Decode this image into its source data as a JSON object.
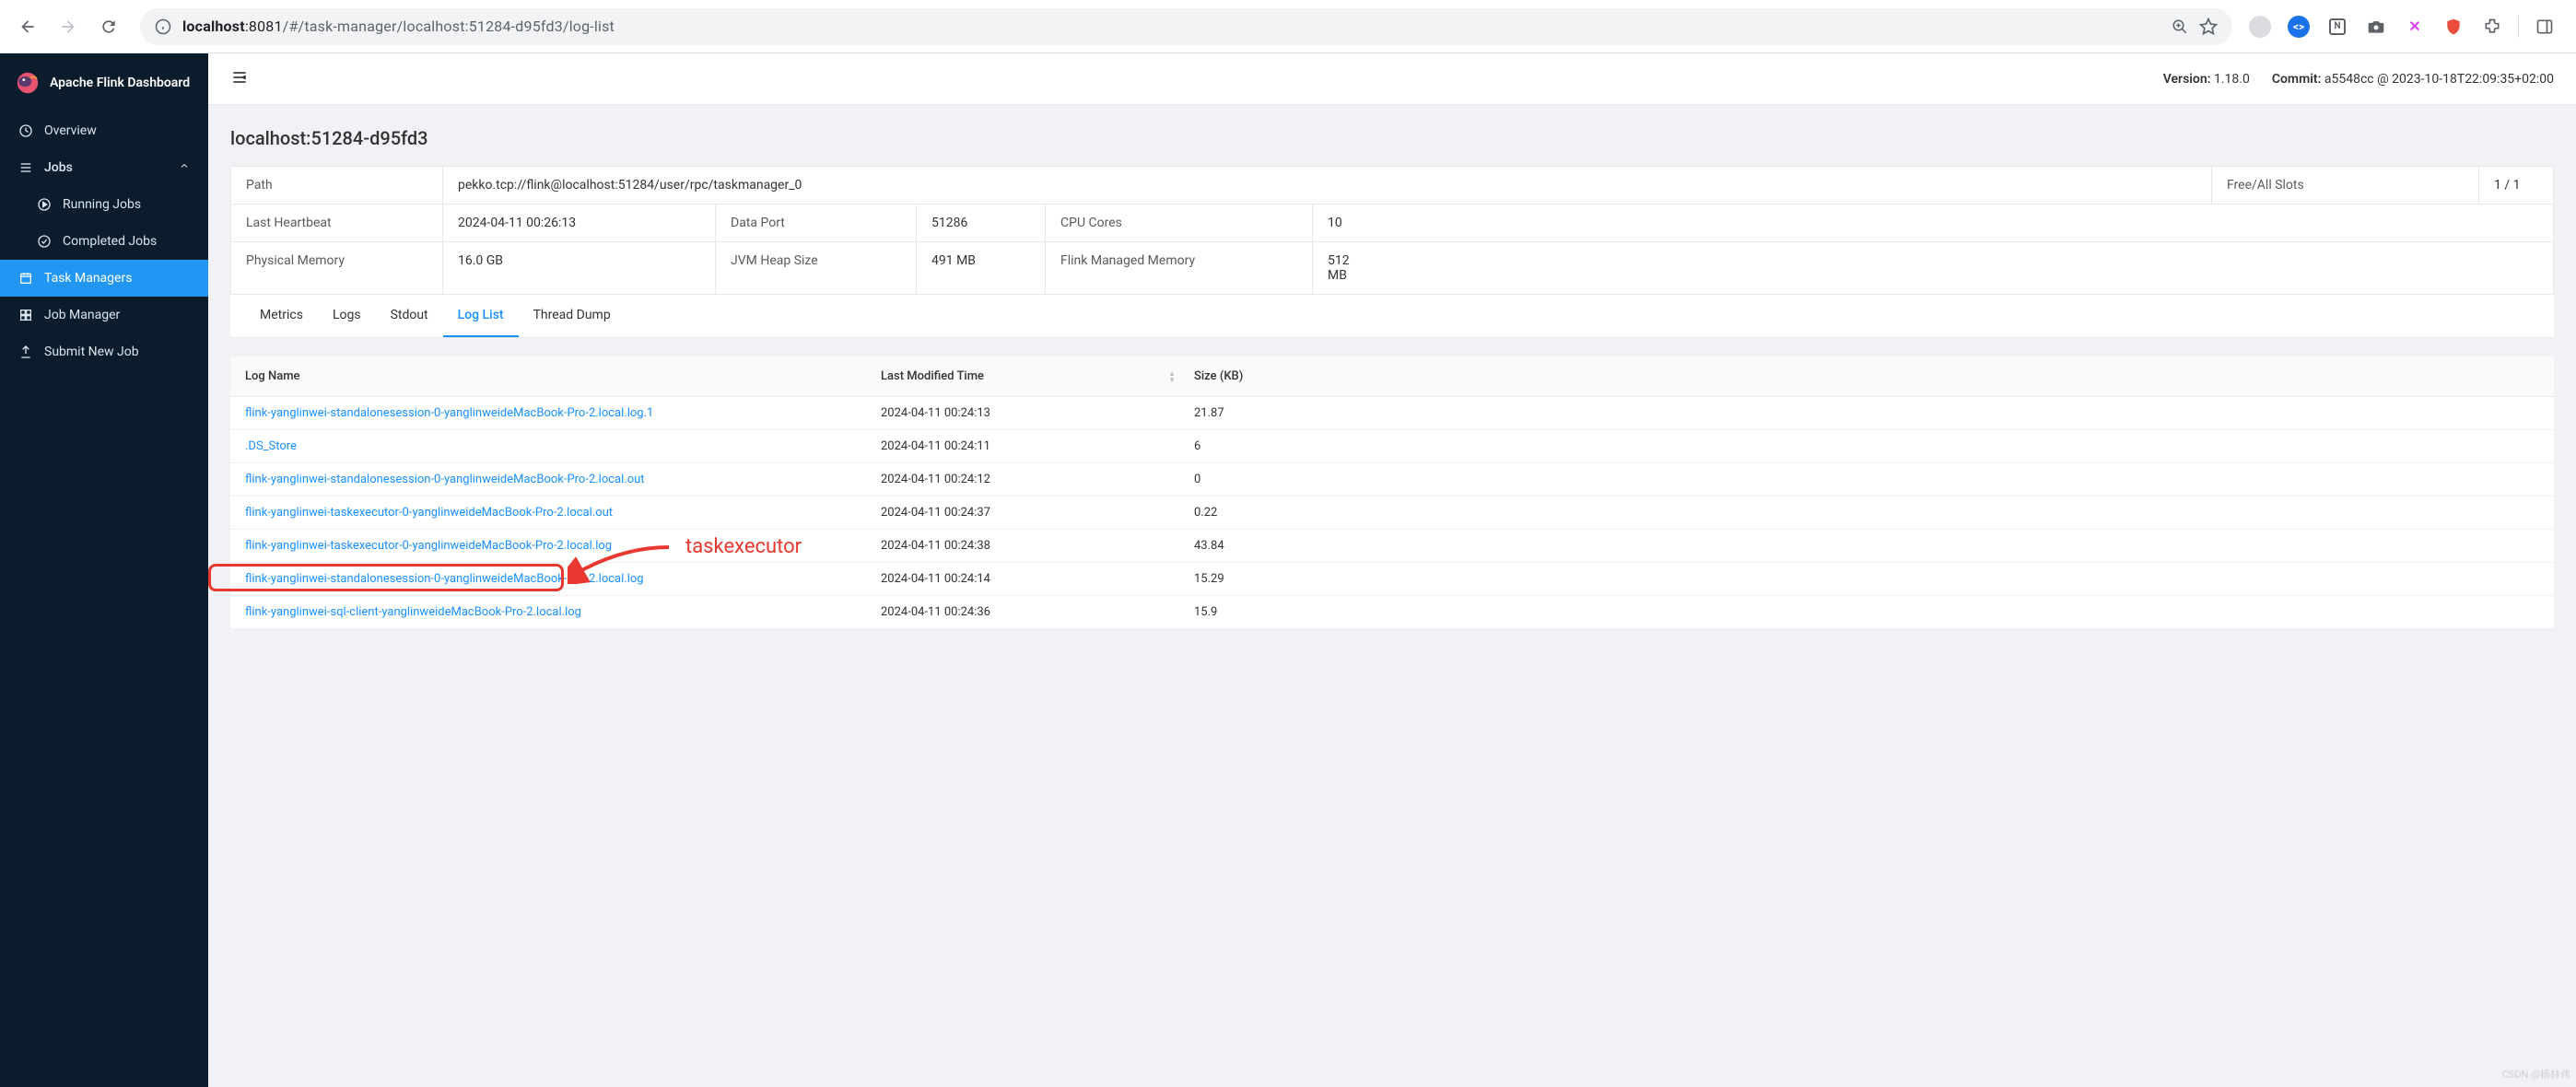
{
  "browser": {
    "url_host": "localhost",
    "url_port": ":8081",
    "url_path": "/#/task-manager/localhost:51284-d95fd3/log-list"
  },
  "brand": "Apache Flink Dashboard",
  "sidebar": {
    "overview": "Overview",
    "jobs": "Jobs",
    "running_jobs": "Running Jobs",
    "completed_jobs": "Completed Jobs",
    "task_managers": "Task Managers",
    "job_manager": "Job Manager",
    "submit_new_job": "Submit New Job"
  },
  "topbar": {
    "version_label": "Version:",
    "version_value": "1.18.0",
    "commit_label": "Commit:",
    "commit_value": "a5548cc @ 2023-10-18T22:09:35+02:00"
  },
  "page_title": "localhost:51284-d95fd3",
  "info": {
    "path_label": "Path",
    "path_value": "pekko.tcp://flink@localhost:51284/user/rpc/taskmanager_0",
    "slots_label": "Free/All Slots",
    "slots_value": "1 / 1",
    "heartbeat_label": "Last Heartbeat",
    "heartbeat_value": "2024-04-11 00:26:13",
    "dataport_label": "Data Port",
    "dataport_value": "51286",
    "cpu_label": "CPU Cores",
    "cpu_value": "10",
    "physmem_label": "Physical Memory",
    "physmem_value": "16.0 GB",
    "jvmheap_label": "JVM Heap Size",
    "jvmheap_value": "491 MB",
    "managedmem_label": "Flink Managed Memory",
    "managedmem_value": "512 MB"
  },
  "tabs": {
    "metrics": "Metrics",
    "logs": "Logs",
    "stdout": "Stdout",
    "loglist": "Log List",
    "threaddump": "Thread Dump"
  },
  "table": {
    "header_name": "Log Name",
    "header_time": "Last Modified Time",
    "header_size": "Size (KB)"
  },
  "logs": [
    {
      "name": "flink-yanglinwei-standalonesession-0-yanglinweideMacBook-Pro-2.local.log.1",
      "time": "2024-04-11 00:24:13",
      "size": "21.87"
    },
    {
      "name": ".DS_Store",
      "time": "2024-04-11 00:24:11",
      "size": "6"
    },
    {
      "name": "flink-yanglinwei-standalonesession-0-yanglinweideMacBook-Pro-2.local.out",
      "time": "2024-04-11 00:24:12",
      "size": "0"
    },
    {
      "name": "flink-yanglinwei-taskexecutor-0-yanglinweideMacBook-Pro-2.local.out",
      "time": "2024-04-11 00:24:37",
      "size": "0.22"
    },
    {
      "name": "flink-yanglinwei-taskexecutor-0-yanglinweideMacBook-Pro-2.local.log",
      "time": "2024-04-11 00:24:38",
      "size": "43.84"
    },
    {
      "name": "flink-yanglinwei-standalonesession-0-yanglinweideMacBook-Pro-2.local.log",
      "time": "2024-04-11 00:24:14",
      "size": "15.29"
    },
    {
      "name": "flink-yanglinwei-sql-client-yanglinweideMacBook-Pro-2.local.log",
      "time": "2024-04-11 00:24:36",
      "size": "15.9"
    }
  ],
  "annotation": {
    "label": "taskexecutor"
  },
  "watermark": "CSDN @杨林伟"
}
